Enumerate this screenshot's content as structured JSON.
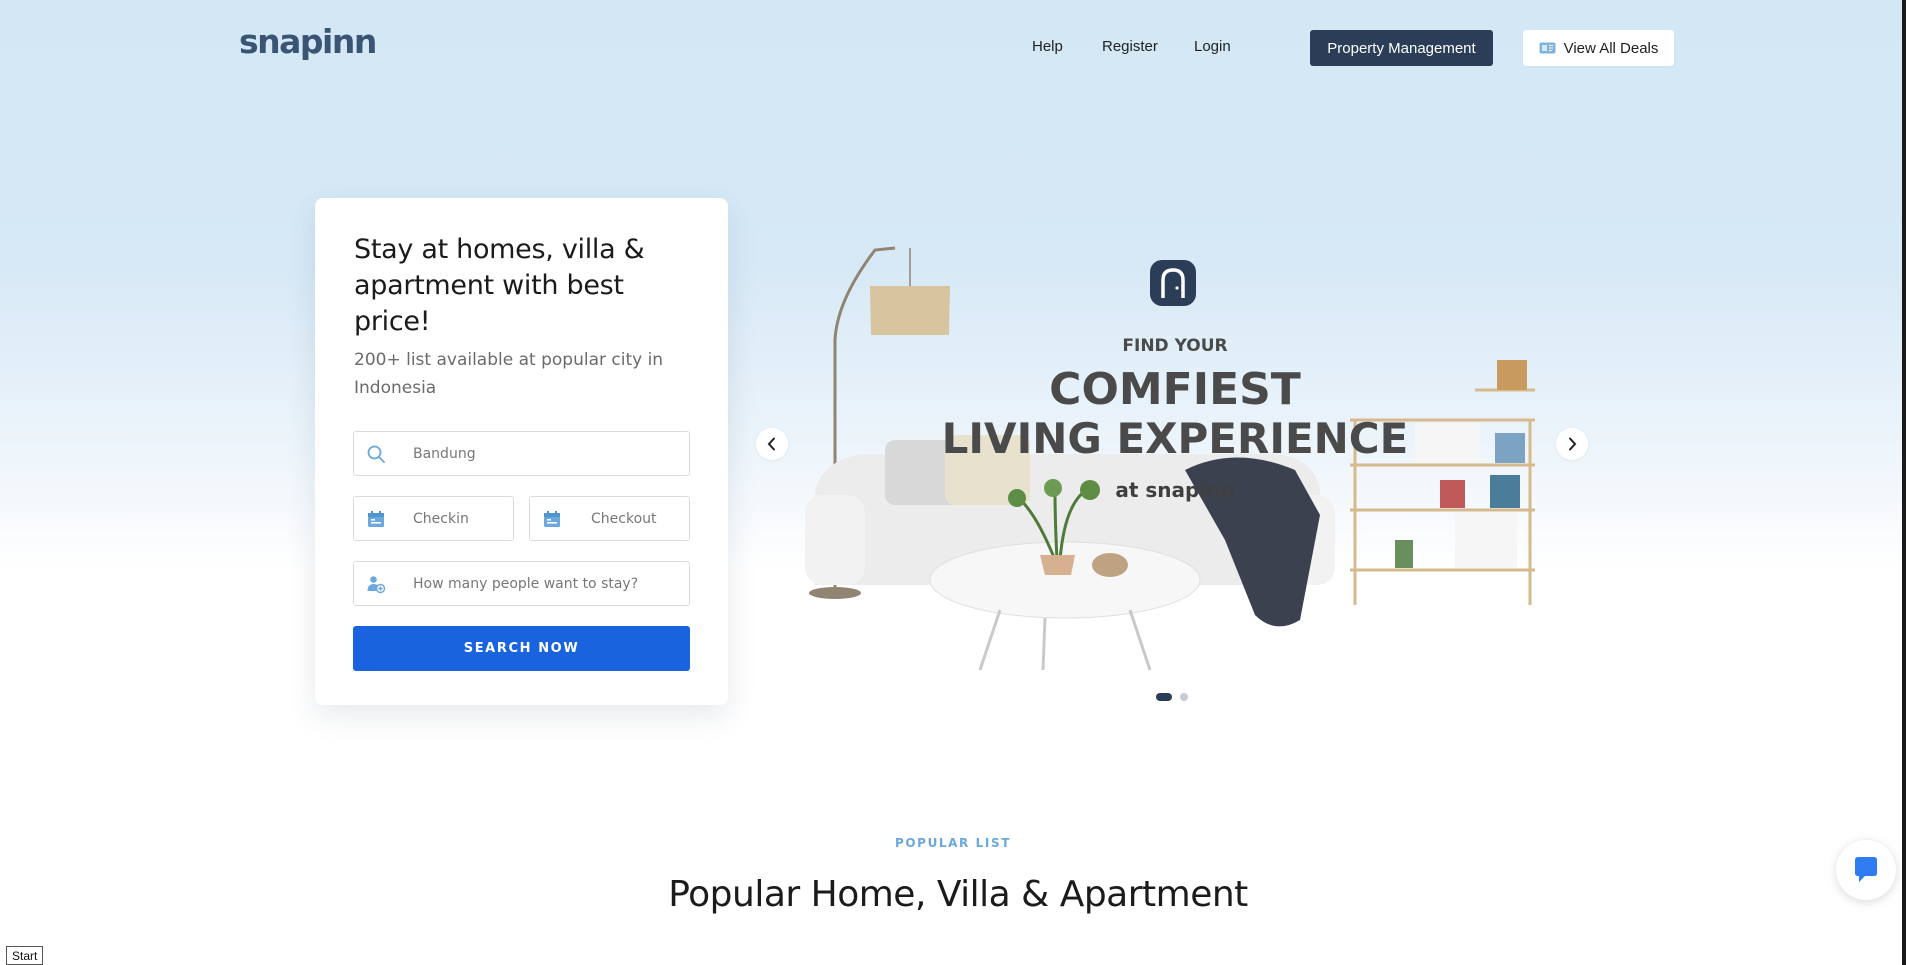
{
  "header": {
    "logo_text": "snapinn",
    "nav": {
      "help": "Help",
      "register": "Register",
      "login": "Login"
    },
    "property_management_label": "Property Management",
    "view_deals_label": "View All Deals"
  },
  "search_card": {
    "title": "Stay at homes, villa & apartment with best price!",
    "subtitle": "200+ list available at popular city in Indonesia",
    "location_value": "Bandung",
    "checkin_placeholder": "Checkin",
    "checkout_placeholder": "Checkout",
    "guests_placeholder": "How many people want to stay?",
    "search_button_label": "SEARCH NOW"
  },
  "carousel": {
    "slide": {
      "line1": "FIND YOUR",
      "line2": "COMFIEST",
      "line3": "LIVING EXPERIENCE",
      "line4": "at snapinn"
    },
    "slides_count": 2,
    "active_slide": 1
  },
  "popular": {
    "eyebrow": "POPULAR LIST",
    "title": "Popular Home, Villa & Apartment"
  },
  "taskbar": {
    "start_label": "Start"
  },
  "colors": {
    "brand_dark": "#2c3e57",
    "primary_blue": "#1a63de",
    "accent_light_blue": "#6ba9dc"
  }
}
